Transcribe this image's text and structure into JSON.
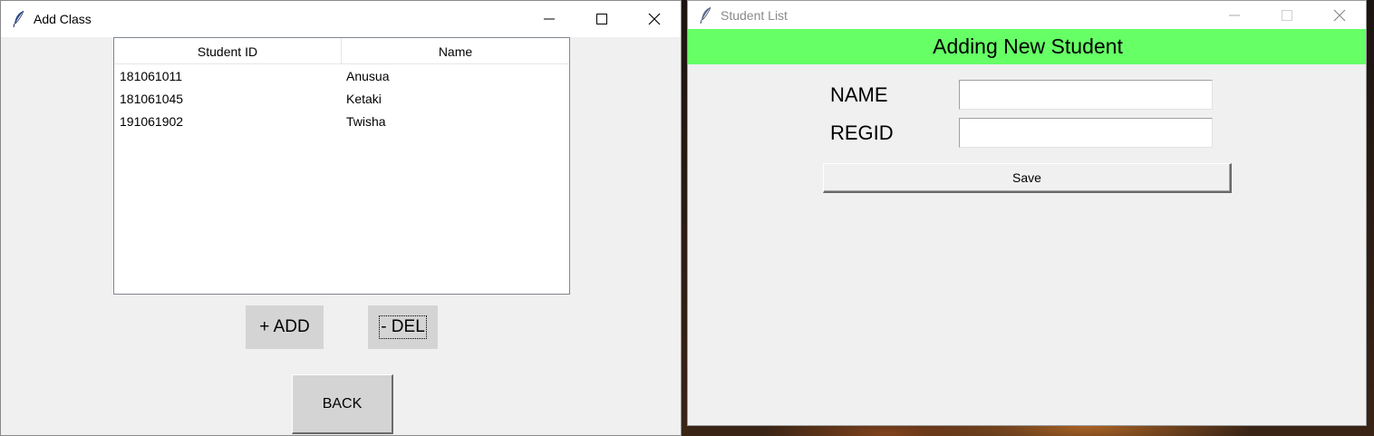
{
  "left_window": {
    "title": "Add Class",
    "table": {
      "columns": [
        "Student ID",
        "Name"
      ],
      "rows": [
        [
          "181061011",
          "Anusua"
        ],
        [
          "181061045",
          "Ketaki"
        ],
        [
          "191061902",
          "Twisha"
        ]
      ]
    },
    "add_label": "+ ADD",
    "del_label": "- DEL",
    "back_label": "BACK"
  },
  "right_window": {
    "title": "Student List",
    "banner": "Adding New Student",
    "name_label": "NAME",
    "regid_label": "REGID",
    "name_value": "",
    "regid_value": "",
    "save_label": "Save"
  },
  "colors": {
    "banner_green": "#66ff66",
    "window_bg": "#f0f0f0",
    "button_grey": "#d4d4d4"
  },
  "icons": {
    "app_icon": "tk-feather-icon",
    "minimize": "minimize-icon",
    "maximize": "maximize-icon",
    "close": "close-icon"
  }
}
